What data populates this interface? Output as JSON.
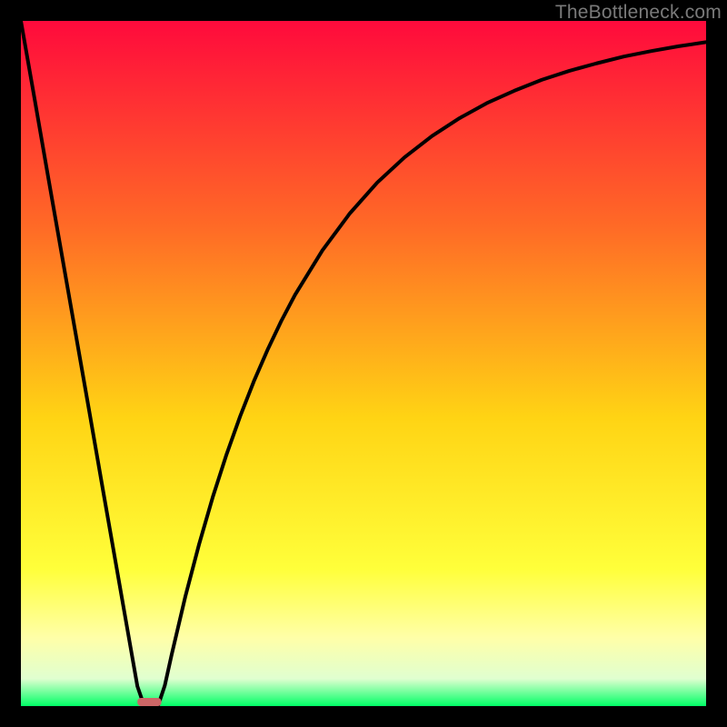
{
  "watermark": "TheBottleneck.com",
  "colors": {
    "gradient_top": "#ff0a3c",
    "gradient_upper_mid": "#ff6a26",
    "gradient_mid": "#ffd414",
    "gradient_lower_yellow": "#ffff3a",
    "gradient_pale_yellow": "#ffffa8",
    "gradient_near_bottom": "#e0ffd0",
    "gradient_bottom": "#00ff66",
    "curve": "#000000",
    "marker": "#cc6666",
    "frame": "#000000"
  },
  "chart_data": {
    "type": "line",
    "title": "",
    "xlabel": "",
    "ylabel": "",
    "xlim": [
      0,
      100
    ],
    "ylim": [
      0,
      100
    ],
    "x": [
      0,
      2,
      4,
      6,
      8,
      10,
      12,
      14,
      16,
      17,
      18,
      19,
      20,
      21,
      22,
      24,
      26,
      28,
      30,
      32,
      34,
      36,
      38,
      40,
      44,
      48,
      52,
      56,
      60,
      64,
      68,
      72,
      76,
      80,
      84,
      88,
      92,
      96,
      100
    ],
    "y": [
      100,
      88.6,
      77.1,
      65.7,
      54.3,
      42.9,
      31.4,
      20.0,
      8.6,
      2.9,
      0,
      0,
      0,
      3.0,
      7.5,
      16.0,
      23.6,
      30.5,
      36.7,
      42.3,
      47.4,
      52.0,
      56.2,
      60.0,
      66.5,
      71.9,
      76.4,
      80.1,
      83.2,
      85.8,
      88.0,
      89.8,
      91.4,
      92.7,
      93.8,
      94.8,
      95.6,
      96.3,
      96.9
    ],
    "minimum_marker": {
      "x_start": 17.0,
      "x_end": 20.5,
      "y": 0
    },
    "notes": "Curve is a V/funnel shape: steep linear drop from (0,100) to a minimum near x≈18.5, then a concave-increasing recovery asymptotically approaching ~97 at x=100. No axis ticks or numeric labels are rendered; values are inferred on a 0–100 normalized scale. A small rounded pink marker sits at the trough on the baseline."
  }
}
